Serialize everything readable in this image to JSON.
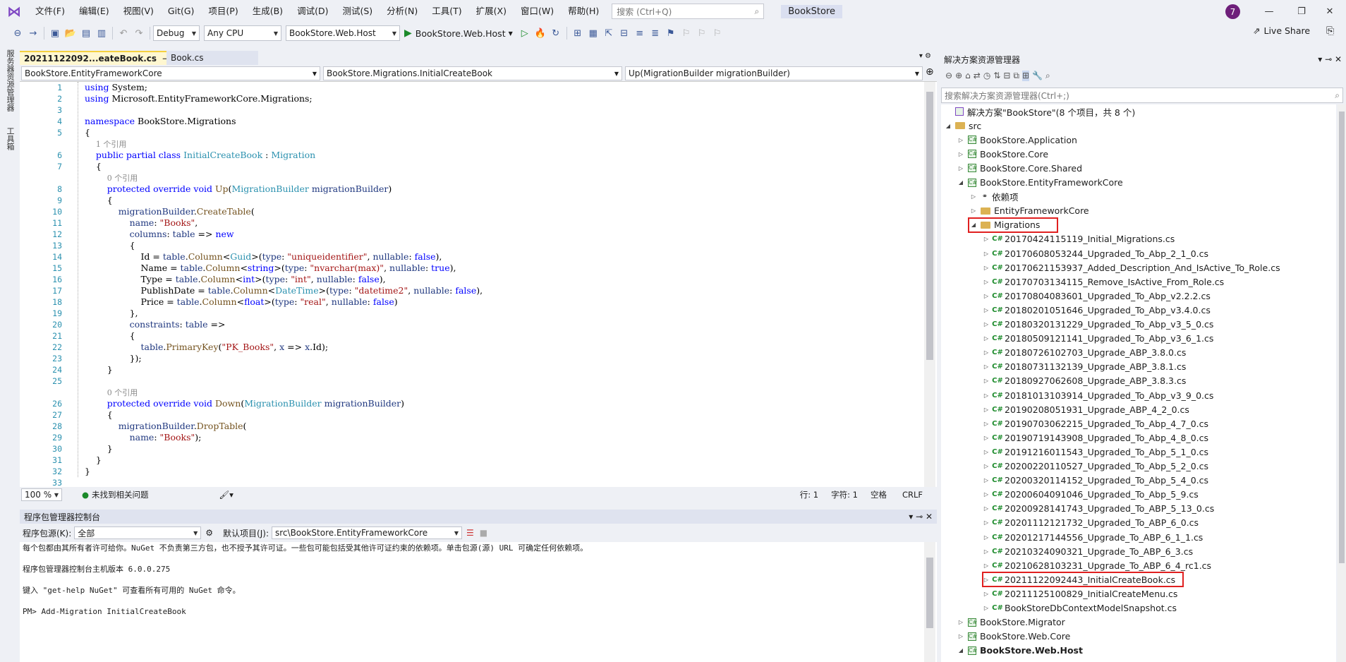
{
  "menu": [
    "文件(F)",
    "编辑(E)",
    "视图(V)",
    "Git(G)",
    "项目(P)",
    "生成(B)",
    "调试(D)",
    "测试(S)",
    "分析(N)",
    "工具(T)",
    "扩展(X)",
    "窗口(W)",
    "帮助(H)"
  ],
  "search_placeholder": "搜索 (Ctrl+Q)",
  "app_title": "BookStore",
  "avatar": "7",
  "live_share": "Live Share",
  "toolbar": {
    "config": "Debug",
    "platform": "Any CPU",
    "startup": "BookStore.Web.Host",
    "run": "BookStore.Web.Host"
  },
  "left_tabs": [
    "服务器资源管理器",
    "工具箱"
  ],
  "tabs": {
    "active": "20211122092...eateBook.cs",
    "other": "Book.cs"
  },
  "nav": {
    "project": "BookStore.EntityFrameworkCore",
    "class": "BookStore.Migrations.InitialCreateBook",
    "member": "Up(MigrationBuilder migrationBuilder)"
  },
  "editor_status": {
    "zoom": "100 %",
    "issues": "未找到相关问题",
    "line": "行: 1",
    "char": "字符: 1",
    "space": "空格",
    "eol": "CRLF"
  },
  "pmc": {
    "title": "程序包管理器控制台",
    "source_label": "程序包源(K):",
    "source_value": "全部",
    "default_label": "默认项目(J):",
    "default_value": "src\\BookStore.EntityFrameworkCore",
    "lines": [
      "每个包都由其所有者许可给你。NuGet 不负责第三方包，也不授予其许可证。一些包可能包括受其他许可证约束的依赖项。单击包源(源) URL 可确定任何依赖项。",
      "程序包管理器控制台主机版本 6.0.0.275",
      "键入 \"get-help NuGet\" 可查看所有可用的 NuGet 命令。",
      "PM> Add-Migration InitialCreateBook"
    ]
  },
  "se": {
    "title": "解决方案资源管理器",
    "search_placeholder": "搜索解决方案资源管理器(Ctrl+;)",
    "solution": "解决方案\"BookStore\"(8 个项目，共 8 个)",
    "src": "src",
    "projects_top": [
      "BookStore.Application",
      "BookStore.Core",
      "BookStore.Core.Shared",
      "BookStore.EntityFrameworkCore"
    ],
    "deps": "依赖项",
    "ef_folder": "EntityFrameworkCore",
    "migrations": "Migrations",
    "files": [
      "20170424115119_Initial_Migrations.cs",
      "20170608053244_Upgraded_To_Abp_2_1_0.cs",
      "20170621153937_Added_Description_And_IsActive_To_Role.cs",
      "20170703134115_Remove_IsActive_From_Role.cs",
      "20170804083601_Upgraded_To_Abp_v2.2.2.cs",
      "20180201051646_Upgraded_To_Abp_v3.4.0.cs",
      "20180320131229_Upgraded_To_Abp_v3_5_0.cs",
      "20180509121141_Upgraded_To_Abp_v3_6_1.cs",
      "20180726102703_Upgrade_ABP_3.8.0.cs",
      "20180731132139_Upgrade_ABP_3.8.1.cs",
      "20180927062608_Upgrade_ABP_3.8.3.cs",
      "20181013103914_Upgraded_To_Abp_v3_9_0.cs",
      "20190208051931_Upgrade_ABP_4_2_0.cs",
      "20190703062215_Upgraded_To_Abp_4_7_0.cs",
      "20190719143908_Upgraded_To_Abp_4_8_0.cs",
      "20191216011543_Upgraded_To_Abp_5_1_0.cs",
      "20200220110527_Upgraded_To_Abp_5_2_0.cs",
      "20200320114152_Upgraded_To_Abp_5_4_0.cs",
      "20200604091046_Upgraded_To_Abp_5_9.cs",
      "20200928141743_Upgraded_To_ABP_5_13_0.cs",
      "20201112121732_Upgraded_To_ABP_6_0.cs",
      "20201217144556_Upgrade_To_ABP_6_1_1.cs",
      "20210324090321_Upgrade_To_ABP_6_3.cs",
      "20210628103231_Upgrade_To_ABP_6_4_rc1.cs",
      "20211122092443_InitialCreateBook.cs",
      "20211125100829_InitialCreateMenu.cs",
      "BookStoreDbContextModelSnapshot.cs"
    ],
    "projects_bottom": [
      "BookStore.Migrator",
      "BookStore.Web.Core",
      "BookStore.Web.Host"
    ]
  }
}
